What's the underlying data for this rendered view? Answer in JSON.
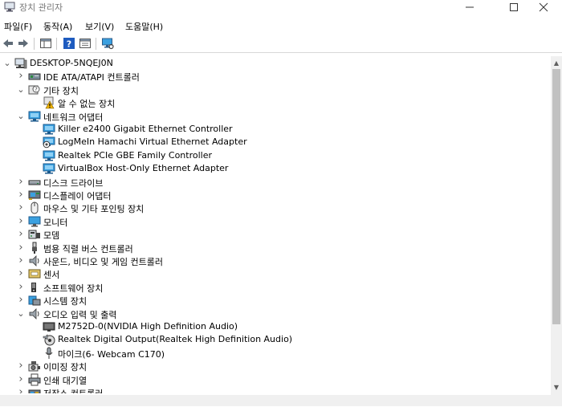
{
  "window": {
    "title": "장치 관리자"
  },
  "menu": [
    "파일(F)",
    "동작(A)",
    "보기(V)",
    "도움말(H)"
  ],
  "tree": {
    "root": "DESKTOP-5NQEJ0N",
    "items": [
      {
        "label": "IDE ATA/ATAPI 컨트롤러",
        "icon": "ide-controller-icon",
        "level": 1,
        "expander": "collapsed"
      },
      {
        "label": "기타 장치",
        "icon": "other-devices-icon",
        "level": 1,
        "expander": "expanded"
      },
      {
        "label": "알 수 없는 장치",
        "icon": "unknown-device-warning-icon",
        "level": 2,
        "expander": "none"
      },
      {
        "label": "네트워크 어댑터",
        "icon": "network-adapter-icon",
        "level": 1,
        "expander": "expanded"
      },
      {
        "label": "Killer e2400 Gigabit Ethernet Controller",
        "icon": "network-adapter-icon",
        "level": 2,
        "expander": "none"
      },
      {
        "label": "LogMeIn Hamachi Virtual Ethernet Adapter",
        "icon": "network-adapter-disabled-icon",
        "level": 2,
        "expander": "none"
      },
      {
        "label": "Realtek PCIe GBE Family Controller",
        "icon": "network-adapter-icon",
        "level": 2,
        "expander": "none"
      },
      {
        "label": "VirtualBox Host-Only Ethernet Adapter",
        "icon": "network-adapter-icon",
        "level": 2,
        "expander": "none"
      },
      {
        "label": "디스크 드라이브",
        "icon": "disk-drive-icon",
        "level": 1,
        "expander": "collapsed"
      },
      {
        "label": "디스플레이 어댑터",
        "icon": "display-adapter-icon",
        "level": 1,
        "expander": "collapsed"
      },
      {
        "label": "마우스 및 기타 포인팅 장치",
        "icon": "mouse-icon",
        "level": 1,
        "expander": "collapsed"
      },
      {
        "label": "모니터",
        "icon": "monitor-icon",
        "level": 1,
        "expander": "collapsed"
      },
      {
        "label": "모뎀",
        "icon": "modem-icon",
        "level": 1,
        "expander": "collapsed"
      },
      {
        "label": "범용 직렬 버스 컨트롤러",
        "icon": "usb-icon",
        "level": 1,
        "expander": "collapsed"
      },
      {
        "label": "사운드, 비디오 및 게임 컨트롤러",
        "icon": "speaker-icon",
        "level": 1,
        "expander": "collapsed"
      },
      {
        "label": "센서",
        "icon": "sensor-icon",
        "level": 1,
        "expander": "collapsed"
      },
      {
        "label": "소프트웨어 장치",
        "icon": "software-device-icon",
        "level": 1,
        "expander": "collapsed"
      },
      {
        "label": "시스템 장치",
        "icon": "system-device-icon",
        "level": 1,
        "expander": "collapsed"
      },
      {
        "label": "오디오 입력 및 출력",
        "icon": "speaker-icon",
        "level": 1,
        "expander": "expanded"
      },
      {
        "label": "M2752D-0(NVIDIA High Definition Audio)",
        "icon": "monitor-audio-icon",
        "level": 2,
        "expander": "none"
      },
      {
        "label": "Realtek Digital Output(Realtek High Definition Audio)",
        "icon": "digital-output-icon",
        "level": 2,
        "expander": "none"
      },
      {
        "label": "마이크(6- Webcam C170)",
        "icon": "microphone-icon",
        "level": 2,
        "expander": "none"
      },
      {
        "label": "이미징 장치",
        "icon": "camera-icon",
        "level": 1,
        "expander": "collapsed"
      },
      {
        "label": "인쇄 대기열",
        "icon": "printer-icon",
        "level": 1,
        "expander": "collapsed"
      },
      {
        "label": "저장소 컨트롤러",
        "icon": "storage-controller-icon",
        "level": 1,
        "expander": "collapsed"
      }
    ]
  },
  "toolbar": {
    "buttons": [
      "back-arrow-icon",
      "forward-arrow-icon",
      "show-hide-console-tree-icon",
      "help-icon",
      "properties-icon",
      "scan-hardware-changes-icon"
    ]
  },
  "colors": {
    "accent": "#1a73c9",
    "warning": "#f0b400"
  }
}
